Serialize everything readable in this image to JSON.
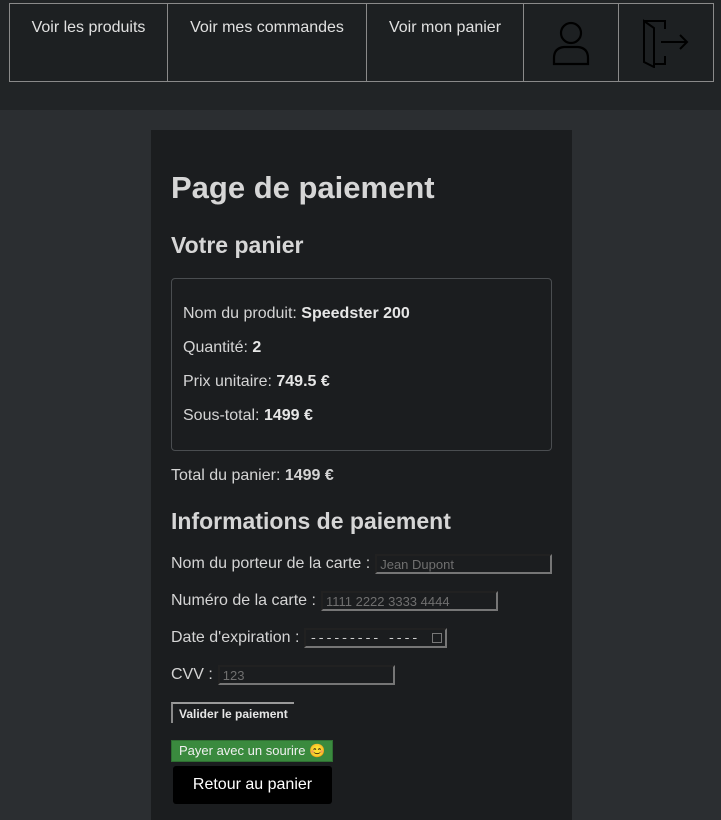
{
  "nav": {
    "products": "Voir les produits",
    "orders": "Voir mes commandes",
    "cart": "Voir mon panier",
    "profile_icon": "user-icon",
    "logout_icon": "logout-icon"
  },
  "page": {
    "title": "Page de paiement",
    "cart_heading": "Votre panier",
    "payment_heading": "Informations de paiement"
  },
  "cart": {
    "product_label": "Nom du produit:",
    "product_value": "Speedster 200",
    "qty_label": "Quantité:",
    "qty_value": "2",
    "unit_label": "Prix unitaire:",
    "unit_value": "749.5 €",
    "subtotal_label": "Sous-total:",
    "subtotal_value": "1499 €",
    "total_label": "Total du panier:",
    "total_value": "1499 €"
  },
  "form": {
    "holder_label": "Nom du porteur de la carte :",
    "holder_placeholder": "Jean Dupont",
    "number_label": "Numéro de la carte :",
    "number_placeholder": "1111 2222 3333 4444",
    "expiry_label": "Date d'expiration :",
    "expiry_value": "--------- ----",
    "cvv_label": "CVV :",
    "cvv_placeholder": "123"
  },
  "buttons": {
    "validate": "Valider le paiement",
    "smile": "Payer avec un sourire 😊",
    "back": "Retour au panier"
  },
  "colors": {
    "smile_button": "#3a8a3e",
    "back_button": "#000000",
    "background": "#2b2e31"
  }
}
